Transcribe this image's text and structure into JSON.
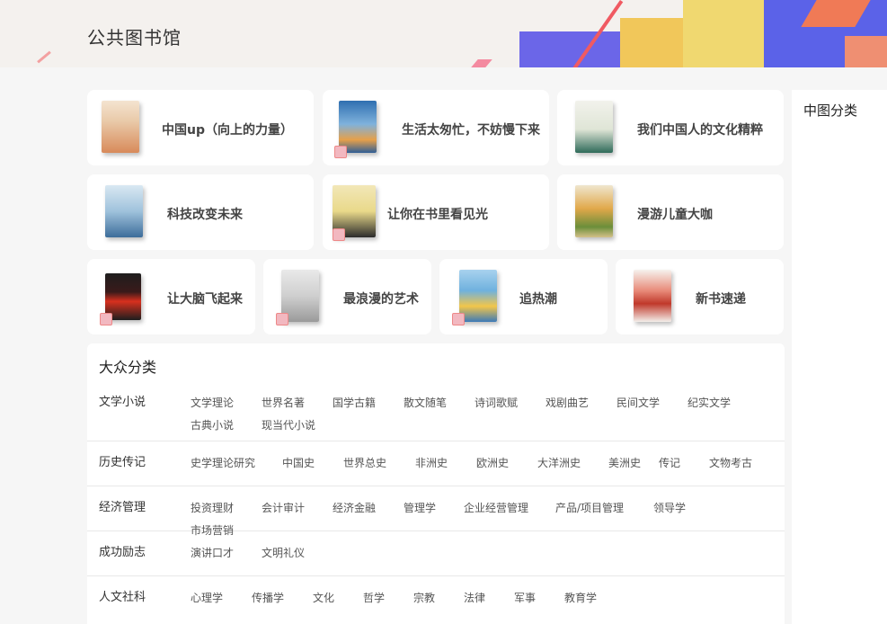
{
  "header": {
    "title": "公共图书馆"
  },
  "cards": [
    {
      "title": "中国up（向上的力量）"
    },
    {
      "title": "生活太匆忙，不妨慢下来"
    },
    {
      "title": "我们中国人的文化精粹"
    },
    {
      "title": "科技改变未来"
    },
    {
      "title": "让你在书里看见光"
    },
    {
      "title": "漫游儿童大咖"
    },
    {
      "title": "让大脑飞起来"
    },
    {
      "title": "最浪漫的艺术"
    },
    {
      "title": "追热潮"
    },
    {
      "title": "新书速递"
    }
  ],
  "side": {
    "title": "中图分类"
  },
  "categories": {
    "title": "大众分类",
    "rows": [
      {
        "label": "文学小说",
        "items": [
          "文学理论",
          "世界名著",
          "国学古籍",
          "散文随笔",
          "诗词歌赋",
          "戏剧曲艺",
          "民间文学",
          "纪实文学",
          "古典小说",
          "现当代小说"
        ]
      },
      {
        "label": "历史传记",
        "items": [
          "史学理论研究",
          "中国史",
          "世界总史",
          "非洲史",
          "欧洲史",
          "大洋洲史",
          "美洲史",
          "传记",
          "文物考古"
        ]
      },
      {
        "label": "经济管理",
        "items": [
          "投资理财",
          "会计审计",
          "经济金融",
          "管理学",
          "企业经营管理",
          "产品/项目管理",
          "领导学",
          "市场营销"
        ]
      },
      {
        "label": "成功励志",
        "items": [
          "演讲口才",
          "文明礼仪"
        ]
      },
      {
        "label": "人文社科",
        "items": [
          "心理学",
          "传播学",
          "文化",
          "哲学",
          "宗教",
          "法律",
          "军事",
          "教育学"
        ]
      }
    ]
  }
}
